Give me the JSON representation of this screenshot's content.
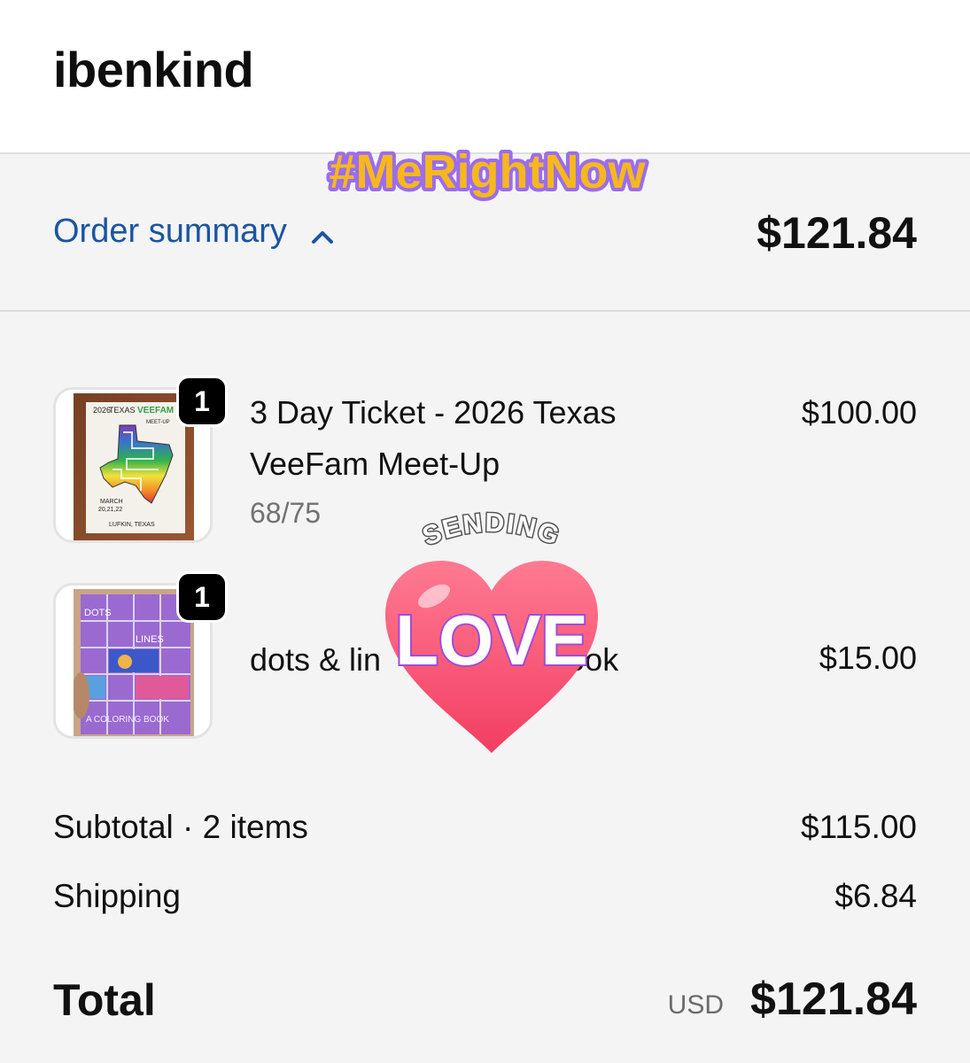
{
  "header": {
    "store_name": "ibenkind"
  },
  "summary": {
    "toggle_label": "Order summary",
    "total": "$121.84"
  },
  "items": [
    {
      "quantity": "1",
      "title": "3 Day Ticket - 2026 Texas VeeFam Meet-Up",
      "variant": "68/75",
      "price": "$100.00",
      "thumbnail": "texas-meetup-map-poster"
    },
    {
      "quantity": "1",
      "title": "dots & lin",
      "title_tail": "ng book",
      "price": "$15.00",
      "thumbnail": "coloring-book-cover"
    }
  ],
  "thumb_text": {
    "poster_2026": "2026",
    "poster_texas": "TEXAS",
    "poster_veefam": "VEEFAM",
    "poster_meetup": "MEET-UP",
    "poster_march": "MARCH",
    "poster_dates": "20,21,22",
    "poster_location": "LUFKIN, TEXAS",
    "book_dots": "DOTS",
    "book_lines": "LINES",
    "book_subtitle": "A COLORING BOOK"
  },
  "totals": {
    "subtotal_label": "Subtotal · 2 items",
    "subtotal_value": "$115.00",
    "shipping_label": "Shipping",
    "shipping_value": "$6.84",
    "total_label": "Total",
    "currency": "USD",
    "total_value": "$121.84"
  },
  "stickers": {
    "hashtag": "#MeRightNow",
    "sending": "SENDING",
    "love": "LOVE"
  },
  "colors": {
    "link": "#1a55a3",
    "background": "#f4f4f4",
    "badge": "#000000",
    "heart": "#ff4d6d"
  }
}
